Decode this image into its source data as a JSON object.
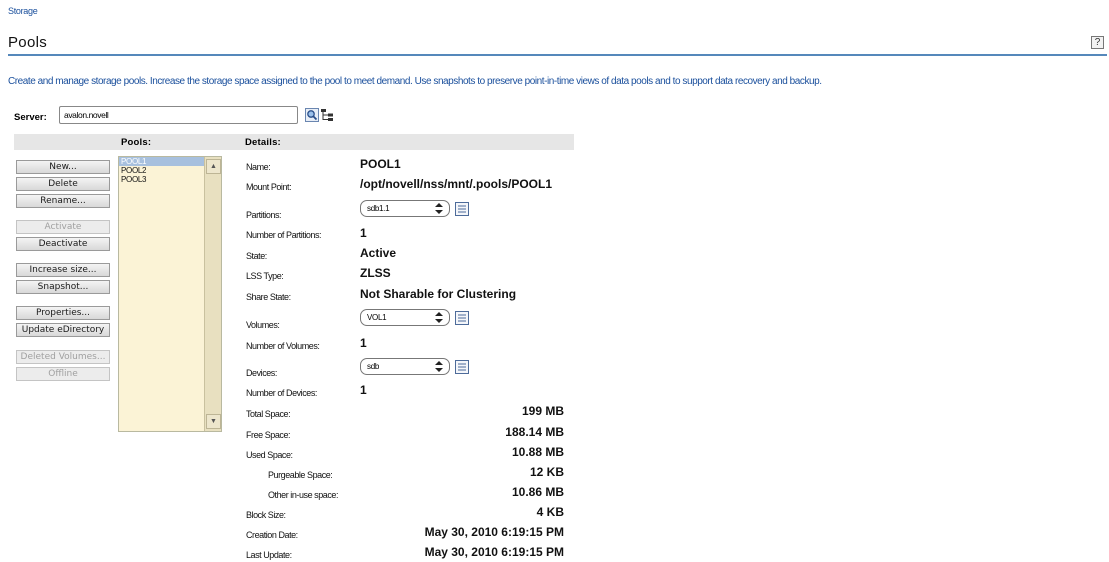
{
  "breadcrumb": "Storage",
  "page_title": "Pools",
  "help_label": "?",
  "description": "Create and manage storage pools. Increase the storage space assigned to the pool to meet demand. Use snapshots to preserve point-in-time views of data pools and to support data recovery and backup.",
  "server": {
    "label": "Server:",
    "value": "avalon.novell"
  },
  "headers": {
    "pools": "Pools:",
    "details": "Details:"
  },
  "buttons": {
    "new": "New...",
    "delete": "Delete",
    "rename": "Rename...",
    "activate": "Activate",
    "deactivate": "Deactivate",
    "increase_size": "Increase size...",
    "snapshot": "Snapshot...",
    "properties": "Properties...",
    "update_edirectory": "Update eDirectory",
    "deleted_volumes": "Deleted Volumes...",
    "offline": "Offline"
  },
  "pools": [
    "POOL1",
    "POOL2",
    "POOL3"
  ],
  "selected_pool": "POOL1",
  "details": {
    "name": {
      "label": "Name:",
      "value": "POOL1"
    },
    "mount_point": {
      "label": "Mount Point:",
      "value": "/opt/novell/nss/mnt/.pools/POOL1"
    },
    "partitions": {
      "label": "Partitions:",
      "selected": "sdb1.1"
    },
    "num_partitions": {
      "label": "Number of Partitions:",
      "value": "1"
    },
    "state": {
      "label": "State:",
      "value": "Active"
    },
    "lss_type": {
      "label": "LSS Type:",
      "value": "ZLSS"
    },
    "share_state": {
      "label": "Share State:",
      "value": "Not Sharable for Clustering"
    },
    "volumes": {
      "label": "Volumes:",
      "selected": "VOL1"
    },
    "num_volumes": {
      "label": "Number of Volumes:",
      "value": "1"
    },
    "devices": {
      "label": "Devices:",
      "selected": "sdb"
    },
    "num_devices": {
      "label": "Number of Devices:",
      "value": "1"
    },
    "total_space": {
      "label": "Total Space:",
      "value": "199 MB"
    },
    "free_space": {
      "label": "Free Space:",
      "value": "188.14 MB"
    },
    "used_space": {
      "label": "Used Space:",
      "value": "10.88 MB"
    },
    "purgeable_space": {
      "label": "Purgeable Space:",
      "value": "12 KB"
    },
    "other_inuse_space": {
      "label": "Other in-use space:",
      "value": "10.86 MB"
    },
    "block_size": {
      "label": "Block Size:",
      "value": "4 KB"
    },
    "creation_date": {
      "label": "Creation Date:",
      "value": "May 30, 2010 6:19:15 PM"
    },
    "last_update": {
      "label": "Last Update:",
      "value": "May 30, 2010 6:19:15 PM"
    }
  },
  "colors": {
    "link_blue": "#1a4f9c",
    "rule_blue": "#5588bb",
    "list_bg": "#fbf3d6",
    "selection": "#a7c0de"
  }
}
